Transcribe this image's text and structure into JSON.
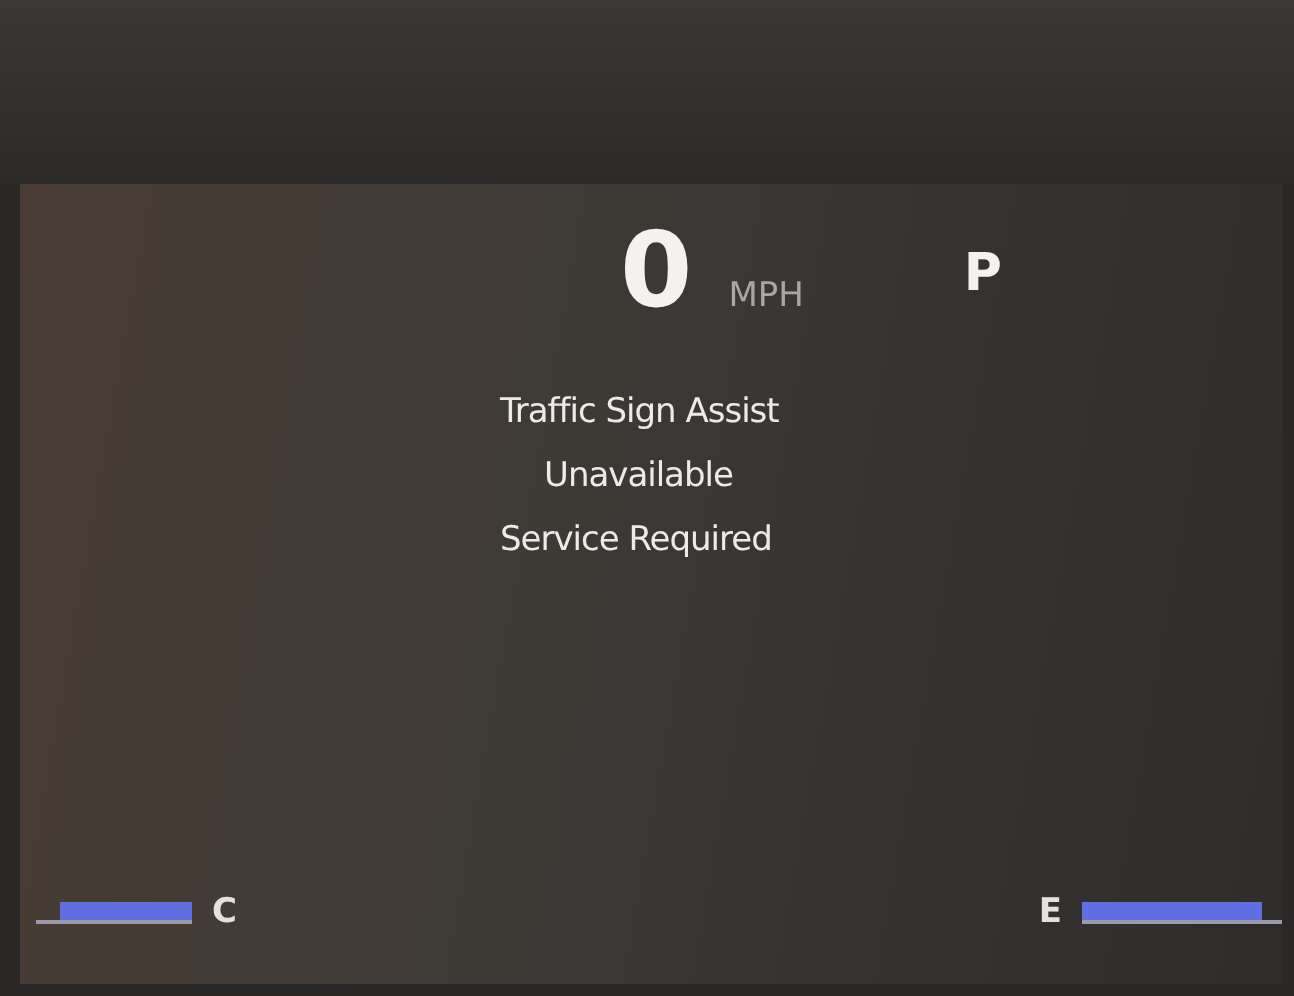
{
  "speed": {
    "value": "0",
    "unit": "MPH"
  },
  "gear": "P",
  "message": [
    "Traffic Sign Assist",
    "Unavailable",
    "Service Required"
  ],
  "gauges": [
    {
      "kind": "temperature",
      "label": "C",
      "level": 0.85
    },
    {
      "kind": "fuel",
      "label": "E",
      "level": 0.9
    }
  ]
}
